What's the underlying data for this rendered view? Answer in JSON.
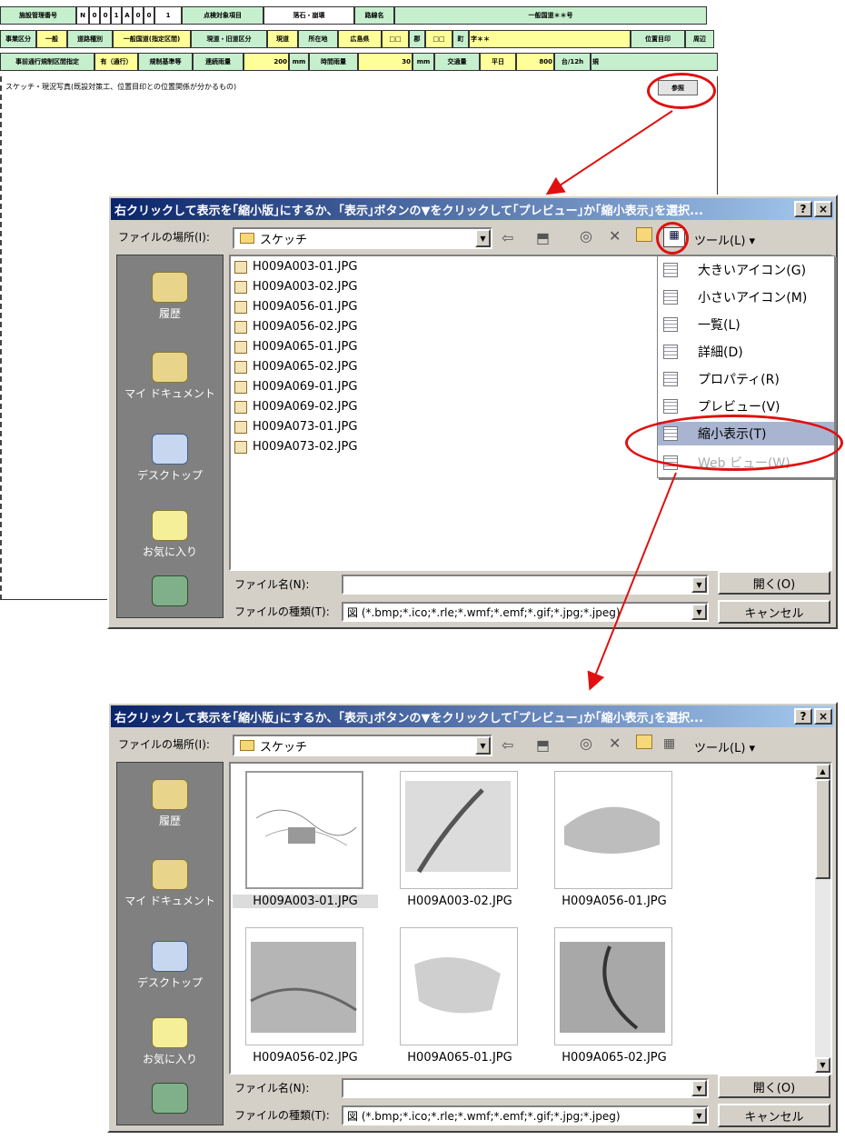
{
  "sheet": {
    "row1": [
      "施設管理番号",
      "N",
      "0",
      "0",
      "1",
      "A",
      "0",
      "0",
      "1",
      "点検対象項目",
      "落石・崩壊",
      "路線名",
      "一般国道＊＊号"
    ],
    "row2": [
      "事業区分",
      "一般",
      "道路種別",
      "一般国道(指定区間)",
      "現道・旧道区分",
      "現道",
      "所在地",
      "広島県",
      "□□",
      "郡",
      "□□",
      "町",
      "字＊＊",
      "位置目印",
      "周辺"
    ],
    "row3": [
      "事前通行規制区間指定",
      "有（通行）",
      "規制基準等",
      "連続雨量",
      "200",
      "mm",
      "時間雨量",
      "30",
      "mm",
      "交通量",
      "平日",
      "800",
      "台/12h",
      "規"
    ],
    "sketch_label": "スケッチ・現況写真(既設対策工、位置目印との位置関係が分かるもの)",
    "ref_button": "参照"
  },
  "dialog1": {
    "title": "右クリックして表示を｢縮小版｣にするか、｢表示｣ボタンの▼をクリックして｢プレビュー｣か｢縮小表示｣を選択...",
    "help": "?",
    "close": "×",
    "lookin_label": "ファイルの場所(I):",
    "lookin_value": "スケッチ",
    "tools_label": "ツール(L)",
    "places": [
      "履歴",
      "マイ ドキュメント",
      "デスクトップ",
      "お気に入り"
    ],
    "files": [
      "H009A003-01.JPG",
      "H009A003-02.JPG",
      "H009A056-01.JPG",
      "H009A056-02.JPG",
      "H009A065-01.JPG",
      "H009A065-02.JPG",
      "H009A069-01.JPG",
      "H009A069-02.JPG",
      "H009A073-01.JPG",
      "H009A073-02.JPG"
    ],
    "filename_label": "ファイル名(N):",
    "filename_value": "",
    "filetype_label": "ファイルの種類(T):",
    "filetype_value": "図 (*.bmp;*.ico;*.rle;*.wmf;*.emf;*.gif;*.jpg;*.jpeg)",
    "open_button": "開く(O)",
    "cancel_button": "キャンセル",
    "view_menu": [
      "大きいアイコン(G)",
      "小さいアイコン(M)",
      "一覧(L)",
      "詳細(D)",
      "プロパティ(R)",
      "プレビュー(V)",
      "縮小表示(T)",
      "Web ビュー(W)"
    ]
  },
  "dialog2": {
    "title": "右クリックして表示を｢縮小版｣にするか、｢表示｣ボタンの▼をクリックして｢プレビュー｣か｢縮小表示｣を選択...",
    "help": "?",
    "close": "×",
    "lookin_label": "ファイルの場所(I):",
    "lookin_value": "スケッチ",
    "tools_label": "ツール(L)",
    "places": [
      "履歴",
      "マイ ドキュメント",
      "デスクトップ",
      "お気に入り"
    ],
    "thumbnails": [
      "H009A003-01.JPG",
      "H009A003-02.JPG",
      "H009A056-01.JPG",
      "H009A056-02.JPG",
      "H009A065-01.JPG",
      "H009A065-02.JPG"
    ],
    "filename_label": "ファイル名(N):",
    "filename_value": "",
    "filetype_label": "ファイルの種類(T):",
    "filetype_value": "図 (*.bmp;*.ico;*.rle;*.wmf;*.emf;*.gif;*.jpg;*.jpeg)",
    "open_button": "開く(O)",
    "cancel_button": "キャンセル"
  },
  "colors": {
    "annotation": "#e01010",
    "titlebar": "#0a246a",
    "face": "#d4d0c8"
  }
}
